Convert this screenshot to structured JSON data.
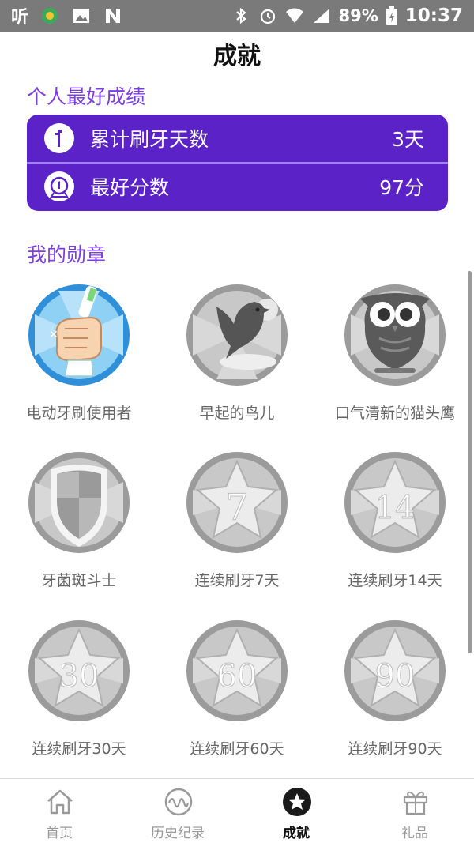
{
  "status_bar": {
    "carrier_logo": "听",
    "battery_percent": "89%",
    "time": "10:37",
    "icons": [
      "notification-icon",
      "image-icon",
      "n-app-icon",
      "bluetooth-icon",
      "alarm-icon",
      "wifi-icon",
      "signal-icon",
      "battery-icon"
    ]
  },
  "header": {
    "title": "成就"
  },
  "personal_best": {
    "section_title": "个人最好成绩",
    "rows": [
      {
        "label": "累计刷牙天数",
        "value": "3天",
        "icon": "toothbrush-icon"
      },
      {
        "label": "最好分数",
        "value": "97分",
        "icon": "score-medal-icon"
      }
    ]
  },
  "badges": {
    "section_title": "我的勋章",
    "items": [
      {
        "label": "电动牙刷使用者",
        "earned": true,
        "icon": "toothbrush-hand-badge"
      },
      {
        "label": "早起的鸟儿",
        "earned": false,
        "icon": "bird-badge"
      },
      {
        "label": "口气清新的猫头鹰",
        "earned": false,
        "icon": "owl-badge"
      },
      {
        "label": "牙菌斑斗士",
        "earned": false,
        "icon": "shield-badge"
      },
      {
        "label": "连续刷牙7天",
        "earned": false,
        "icon": "star-badge",
        "number": "7"
      },
      {
        "label": "连续刷牙14天",
        "earned": false,
        "icon": "star-badge",
        "number": "14"
      },
      {
        "label": "连续刷牙30天",
        "earned": false,
        "icon": "star-badge",
        "number": "30"
      },
      {
        "label": "连续刷牙60天",
        "earned": false,
        "icon": "star-badge",
        "number": "60"
      },
      {
        "label": "连续刷牙90天",
        "earned": false,
        "icon": "star-badge",
        "number": "90"
      }
    ]
  },
  "bottom_nav": {
    "items": [
      {
        "label": "首页",
        "icon": "home-icon",
        "active": false
      },
      {
        "label": "历史纪录",
        "icon": "history-icon",
        "active": false
      },
      {
        "label": "成就",
        "icon": "star-icon",
        "active": true
      },
      {
        "label": "礼品",
        "icon": "gift-icon",
        "active": false
      }
    ]
  },
  "colors": {
    "accent": "#7b3fe0",
    "card_bg": "#5b22c8",
    "medal_gray": "#a9a9a9",
    "medal_blue": "#3aa5e8"
  }
}
